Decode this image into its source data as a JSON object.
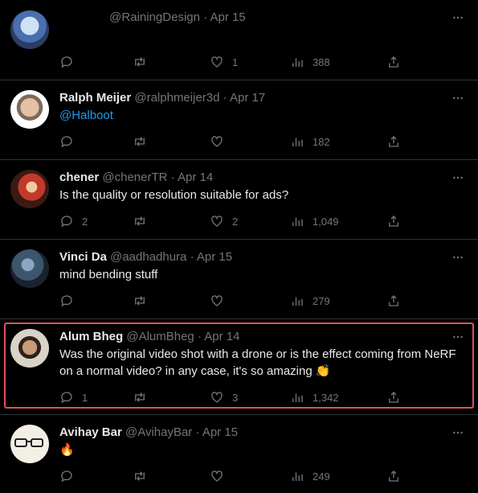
{
  "tweets": [
    {
      "name": "",
      "handle": "@RainingDesign",
      "date": "Apr 15",
      "text": "",
      "replies": "",
      "likes": "1",
      "views": "388"
    },
    {
      "name": "Ralph Meijer",
      "handle": "@ralphmeijer3d",
      "date": "Apr 17",
      "text": "@Halboot",
      "replies": "",
      "likes": "",
      "views": "182"
    },
    {
      "name": "chener",
      "handle": "@chenerTR",
      "date": "Apr 14",
      "text": "Is the quality or resolution suitable for ads?",
      "replies": "2",
      "likes": "2",
      "views": "1,049"
    },
    {
      "name": "Vinci Da",
      "handle": "@aadhadhura",
      "date": "Apr 15",
      "text": "mind bending stuff",
      "replies": "",
      "likes": "",
      "views": "279"
    },
    {
      "name": "Alum Bheg",
      "handle": "@AlumBheg",
      "date": "Apr 14",
      "text": "Was the original video shot with a drone or is the effect coming from NeRF on a normal video? in any case, it's so amazing 👏",
      "replies": "1",
      "likes": "3",
      "views": "1,342"
    },
    {
      "name": "Avihay Bar",
      "handle": "@AvihayBar",
      "date": "Apr 15",
      "text": "🔥",
      "replies": "",
      "likes": "",
      "views": "249"
    }
  ],
  "separator": "·",
  "colors": {
    "background": "#000000",
    "text": "#e7e9ea",
    "muted": "#71767b",
    "link": "#1d9bf0",
    "highlight": "#e0505e"
  },
  "icons": [
    "reply-icon",
    "retweet-icon",
    "like-icon",
    "views-icon",
    "share-icon",
    "more-icon"
  ]
}
